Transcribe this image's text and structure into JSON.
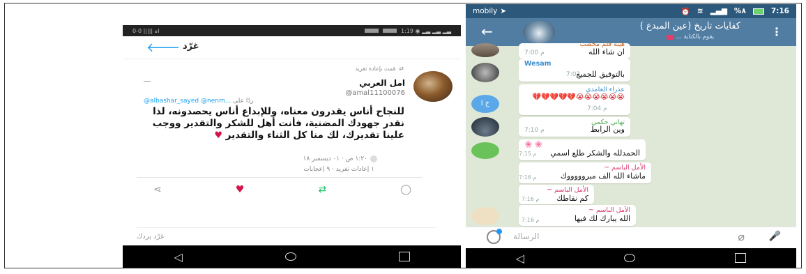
{
  "left_phone": {
    "status": {
      "left": "0-0 ||||| اہ",
      "right": "1:19 ◉ ▂▃ ▂▃ ▂▃"
    },
    "header": {
      "back_icon": "arrow-back-icon",
      "title": "غرّد"
    },
    "retweet_label": "قمت بإعادة تغريد",
    "author_name": "امل العربي",
    "author_handle": "@amal11100076",
    "reply_to_prefix": "ردًا على",
    "reply_to_handles": "@albashar_sayed @nenm...",
    "tweet_text": "للنجاح أناس يقدرون معناه، وللإبداع أناس يحصدونه، لذا نقدر جهودك المضنية، فأنت أهل للشكر والتقدير ووجب علينا تقديرك، لك منا كل الثناء والتقدير",
    "tweet_time": "١:٢٠ ص · ٠١ ديسمبر ١٨",
    "tweet_stats": "١ إعادات تغريد · ٩ إعجابات",
    "reply_placeholder": "غرّد بردك",
    "actions": [
      "share-icon",
      "heart-icon",
      "retweet-icon",
      "reply-icon"
    ],
    "colors": {
      "accent": "#1da1f2",
      "heart": "#d6134a",
      "retweet": "#17bf63"
    }
  },
  "right_phone": {
    "status": {
      "carrier": "mobily",
      "time": "7:16",
      "battery": "%٨"
    },
    "header": {
      "title": "كفايات تاريخ (عين المبدع )",
      "typing": "يقوم بالكتابة ..."
    },
    "messages": [
      {
        "sender": "هيبة قلم محصب",
        "text": "ان شاء الله",
        "time": "7:00 م",
        "sender_color": "#c56a2c"
      },
      {
        "sender": "Wesam",
        "text": "بالتوفيق للجميع",
        "time": "7:03 م",
        "sender_color": "#3a8fd0"
      },
      {
        "sender": "عذراء الغامدي",
        "text": "😭😭😭😭😭😭💔💔💔💔💔",
        "time": "7:04 م",
        "sender_color": "#3a8fd0"
      },
      {
        "sender": "تهاني حكمي",
        "text": "وين الرابط",
        "time": "7:10 م",
        "sender_color": "#4caf50"
      },
      {
        "sender": "🌸 🌸",
        "text": "الحمدلله والشكر طلع اسمي",
        "time": "7:15 م",
        "sender_color": "#d63d6a"
      },
      {
        "sender": "الأمل الباسم ~",
        "text": "ماشاء الله الف مبروووووك",
        "time": "7:16 م",
        "sender_color": "#d63d6a"
      },
      {
        "sender": "الأمل الباسم ~",
        "text": "كم نقاطك",
        "time": "7:16 م",
        "sender_color": "#d63d6a"
      },
      {
        "sender": "الأمل الباسم ~",
        "text": "الله يبارك لك فيها",
        "time": "7:16 م",
        "sender_color": "#d63d6a"
      }
    ],
    "avatar_initials": "خ ا",
    "input_placeholder": "الرسالة",
    "colors": {
      "header": "#517da2",
      "status": "#2c587c",
      "chat_bg": "#dfe8d6"
    }
  },
  "nav_icons": [
    "back-triangle-icon",
    "home-circle-icon",
    "recents-square-icon"
  ]
}
